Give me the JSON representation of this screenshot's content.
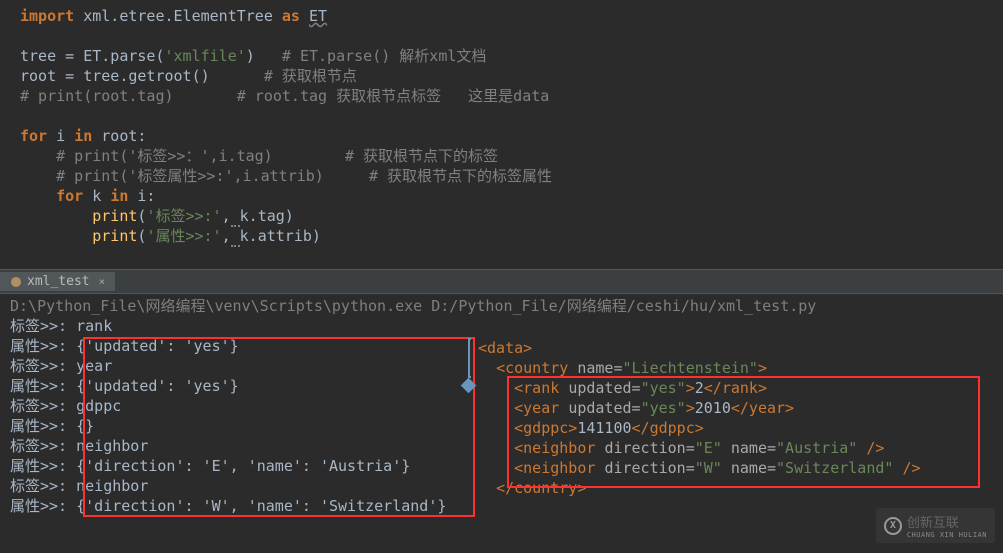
{
  "editor": {
    "lines": [
      {
        "type": "import",
        "content": "import xml.etree.ElementTree as ET"
      },
      {
        "type": "blank",
        "content": ""
      },
      {
        "type": "assign",
        "content": "tree = ET.parse('xmlfile')   # ET.parse() 解析xml文档"
      },
      {
        "type": "assign",
        "content": "root = tree.getroot()      # 获取根节点"
      },
      {
        "type": "comment",
        "content": "# print(root.tag)       # root.tag 获取根节点标签   这里是data"
      },
      {
        "type": "blank",
        "content": ""
      },
      {
        "type": "for",
        "content": "for i in root:"
      },
      {
        "type": "comment",
        "content": "    # print('标签>>：',i.tag)        # 获取根节点下的标签"
      },
      {
        "type": "comment",
        "content": "    # print('标签属性>>:',i.attrib)     # 获取根节点下的标签属性"
      },
      {
        "type": "inner_for",
        "content": "    for k in i:"
      },
      {
        "type": "print",
        "content": "        print('标签>>:',k.tag)"
      },
      {
        "type": "print",
        "content": "        print('属性>>:',k.attrib)"
      }
    ]
  },
  "tab": {
    "name": "xml_test"
  },
  "console": {
    "path_line": "D:\\Python_File\\网络编程\\venv\\Scripts\\python.exe D:/Python_File/网络编程/ceshi/hu/xml_test.py",
    "output": [
      "标签>>: rank",
      "属性>>: {'updated': 'yes'}",
      "标签>>: year",
      "属性>>: {'updated': 'yes'}",
      "标签>>: gdppc",
      "属性>>: {}",
      "标签>>: neighbor",
      "属性>>: {'direction': 'E', 'name': 'Austria'}",
      "标签>>: neighbor",
      "属性>>: {'direction': 'W', 'name': 'Switzerland'}"
    ]
  },
  "xml": {
    "lines": [
      {
        "indent": 0,
        "open": "data",
        "attrs": []
      },
      {
        "indent": 1,
        "open": "country",
        "attrs": [
          {
            "name": "name",
            "value": "Liechtenstein"
          }
        ]
      },
      {
        "indent": 2,
        "open": "rank",
        "attrs": [
          {
            "name": "updated",
            "value": "yes"
          }
        ],
        "text": "2",
        "close": "rank"
      },
      {
        "indent": 2,
        "open": "year",
        "attrs": [
          {
            "name": "updated",
            "value": "yes"
          }
        ],
        "text": "2010",
        "close": "year"
      },
      {
        "indent": 2,
        "open": "gdppc",
        "attrs": [],
        "text": "141100",
        "close": "gdppc"
      },
      {
        "indent": 2,
        "selfclose": "neighbor",
        "attrs": [
          {
            "name": "direction",
            "value": "E"
          },
          {
            "name": "name",
            "value": "Austria"
          }
        ]
      },
      {
        "indent": 2,
        "selfclose": "neighbor",
        "attrs": [
          {
            "name": "direction",
            "value": "W"
          },
          {
            "name": "name",
            "value": "Switzerland"
          }
        ]
      },
      {
        "indent": 1,
        "closeonly": "country"
      }
    ]
  },
  "watermark": {
    "text": "创新互联",
    "subtext": "CHUANG XIN HULIAN"
  }
}
